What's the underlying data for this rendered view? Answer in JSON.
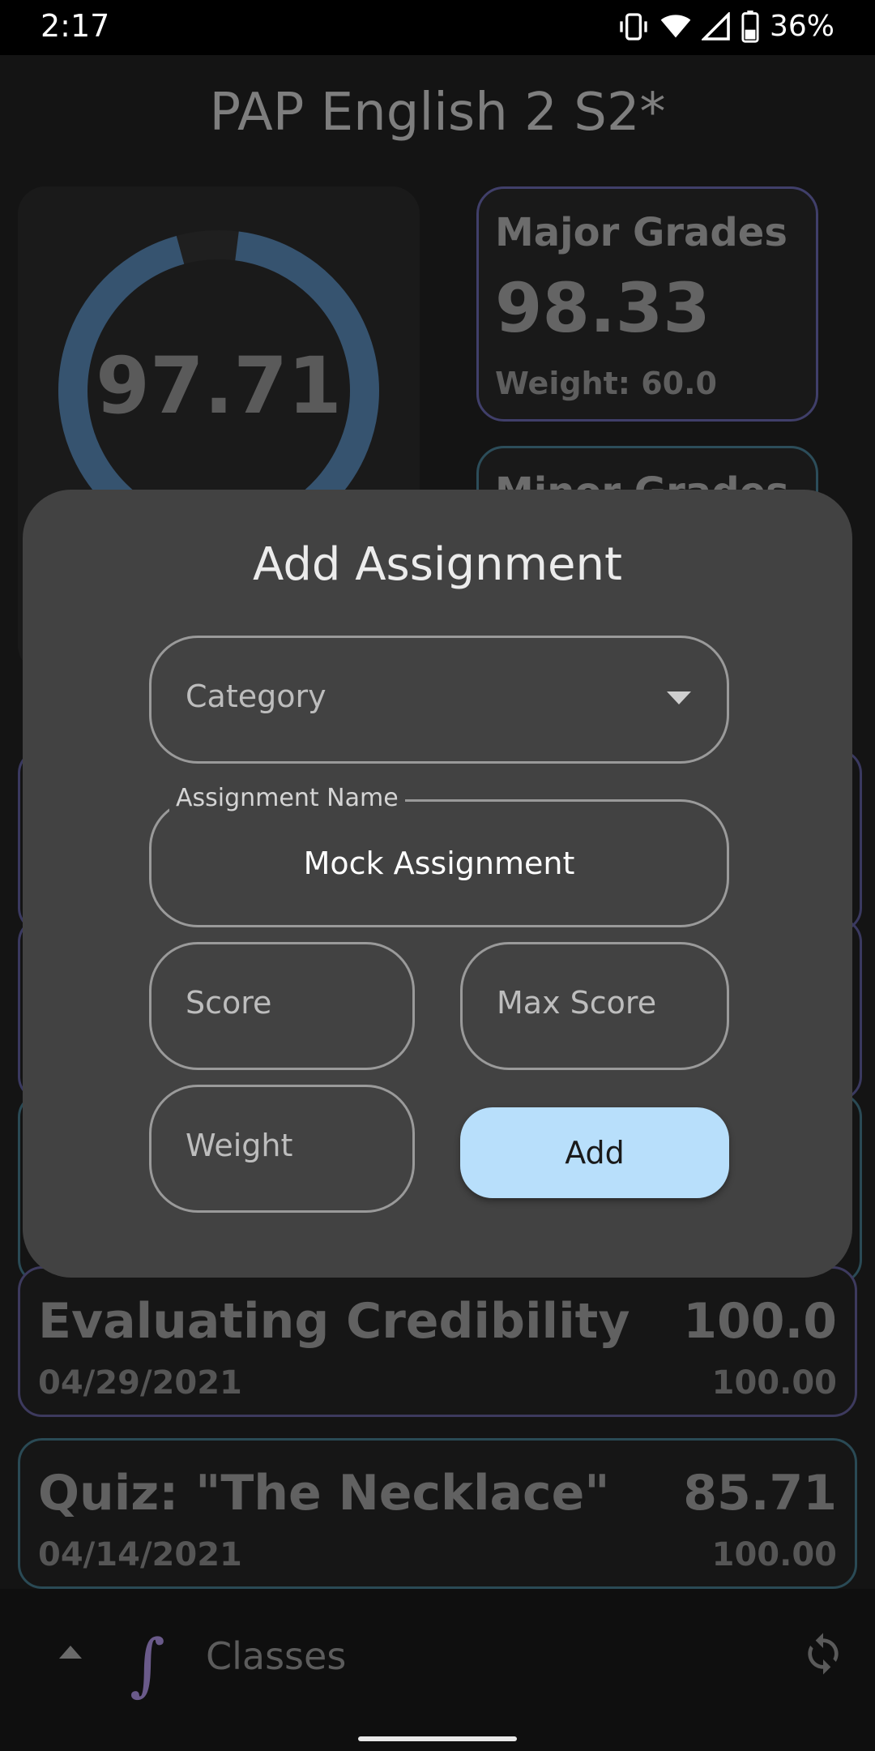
{
  "status_bar": {
    "time": "2:17",
    "battery": "36%"
  },
  "class": {
    "title": "PAP English 2 S2*",
    "overall_grade": "97.71",
    "categories": [
      {
        "name": "Major Grades",
        "value": "98.33",
        "weight": "Weight: 60.0",
        "accent": "#403f6a"
      },
      {
        "name": "Minor Grades",
        "accent": "#2c4d5a"
      }
    ],
    "assignments": [
      {
        "name": "Evaluating Credibility ⋯",
        "date": "04/29/2021",
        "score": "100.0",
        "max": "100.00",
        "accent": "#3d3a5e"
      },
      {
        "name": "Quiz: \"The Necklace\"",
        "date": "04/14/2021",
        "score": "85.71",
        "max": "100.00",
        "accent": "#2a4a55"
      }
    ]
  },
  "gauge": {
    "percent": 97.71,
    "color": "#36536f"
  },
  "dialog": {
    "title": "Add Assignment",
    "category_placeholder": "Category",
    "name_label": "Assignment Name",
    "name_value": "Mock Assignment",
    "score_placeholder": "Score",
    "max_score_placeholder": "Max Score",
    "weight_placeholder": "Weight",
    "add_label": "Add"
  },
  "bottom_bar": {
    "label": "Classes",
    "logo": "∫"
  },
  "icons": {
    "vibrate": "vibrate-icon",
    "wifi": "wifi-icon",
    "signal": "signal-icon",
    "battery": "battery-icon",
    "expand": "chevron-up-icon",
    "logo": "integral-logo-icon",
    "sync": "sync-icon"
  }
}
